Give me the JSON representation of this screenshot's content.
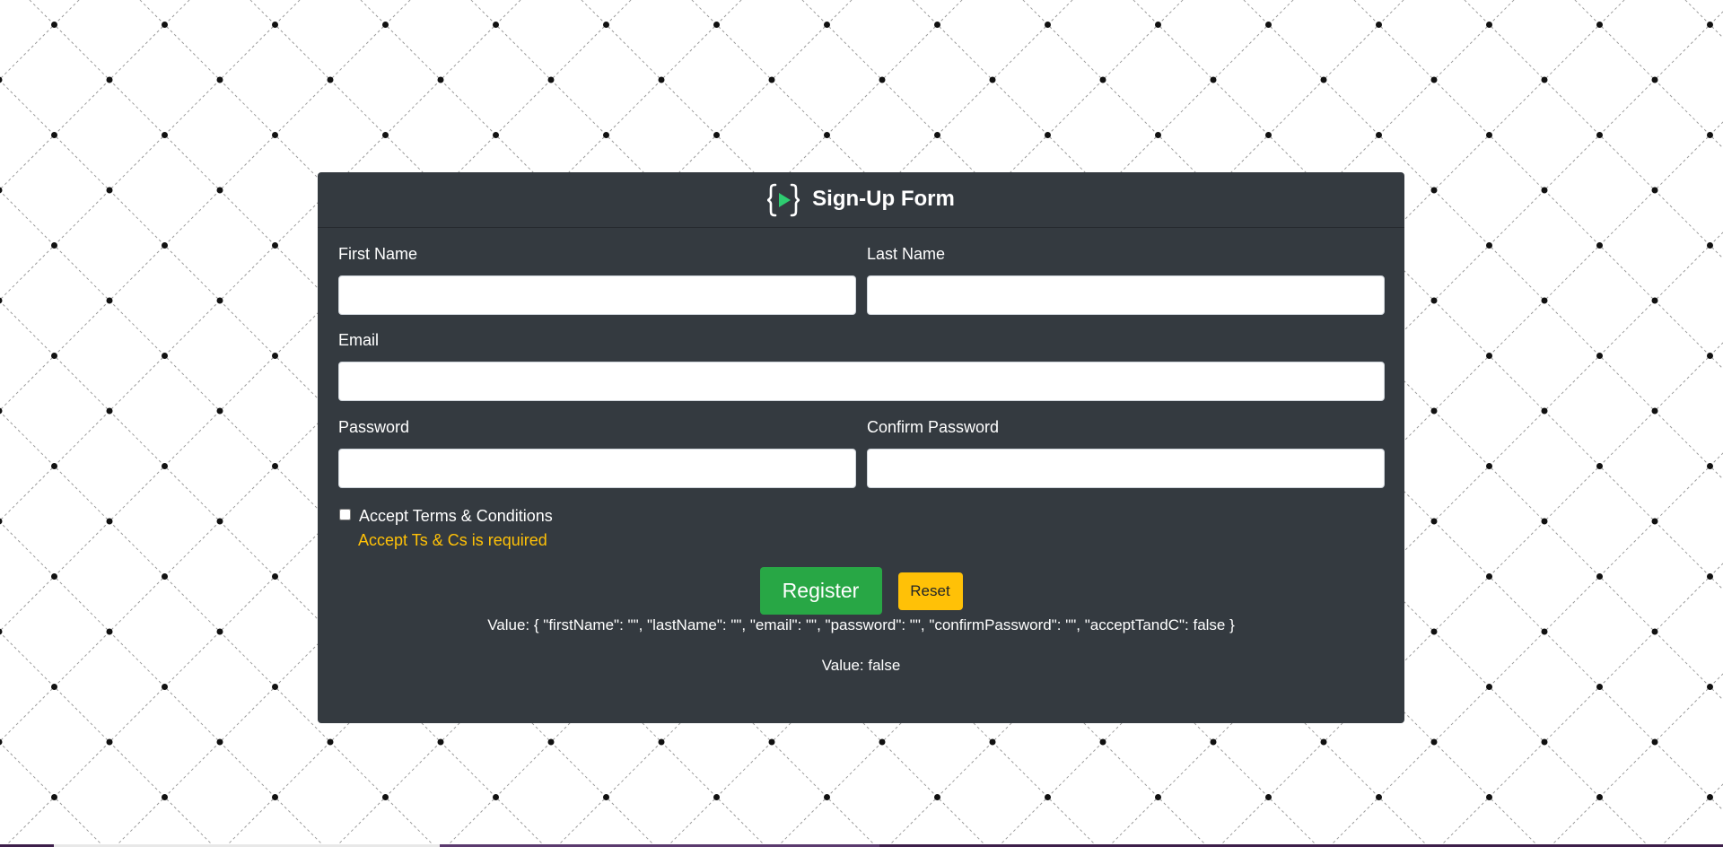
{
  "form": {
    "title": "Sign-Up Form",
    "logo_icon": "curly-brace-play-icon",
    "first_name": {
      "label": "First Name",
      "value": "",
      "placeholder": ""
    },
    "last_name": {
      "label": "Last Name",
      "value": "",
      "placeholder": ""
    },
    "email": {
      "label": "Email",
      "value": "",
      "placeholder": ""
    },
    "password": {
      "label": "Password",
      "value": "",
      "placeholder": ""
    },
    "confirm_password": {
      "label": "Confirm Password",
      "value": "",
      "placeholder": ""
    },
    "accept_terms": {
      "label": "Accept Terms & Conditions",
      "checked": false,
      "error": "Accept Ts & Cs is required"
    },
    "register_label": "Register",
    "reset_label": "Reset",
    "value_json": "Value: { \"firstName\": \"\", \"lastName\": \"\", \"email\": \"\", \"password\": \"\", \"confirmPassword\": \"\", \"acceptTandC\": false }",
    "value_bool": "Value: false"
  },
  "colors": {
    "card_bg": "#343a40",
    "register_bg": "#28a745",
    "reset_bg": "#ffc107",
    "error_text": "#ffc107",
    "logo_accent": "#2ecc71"
  }
}
